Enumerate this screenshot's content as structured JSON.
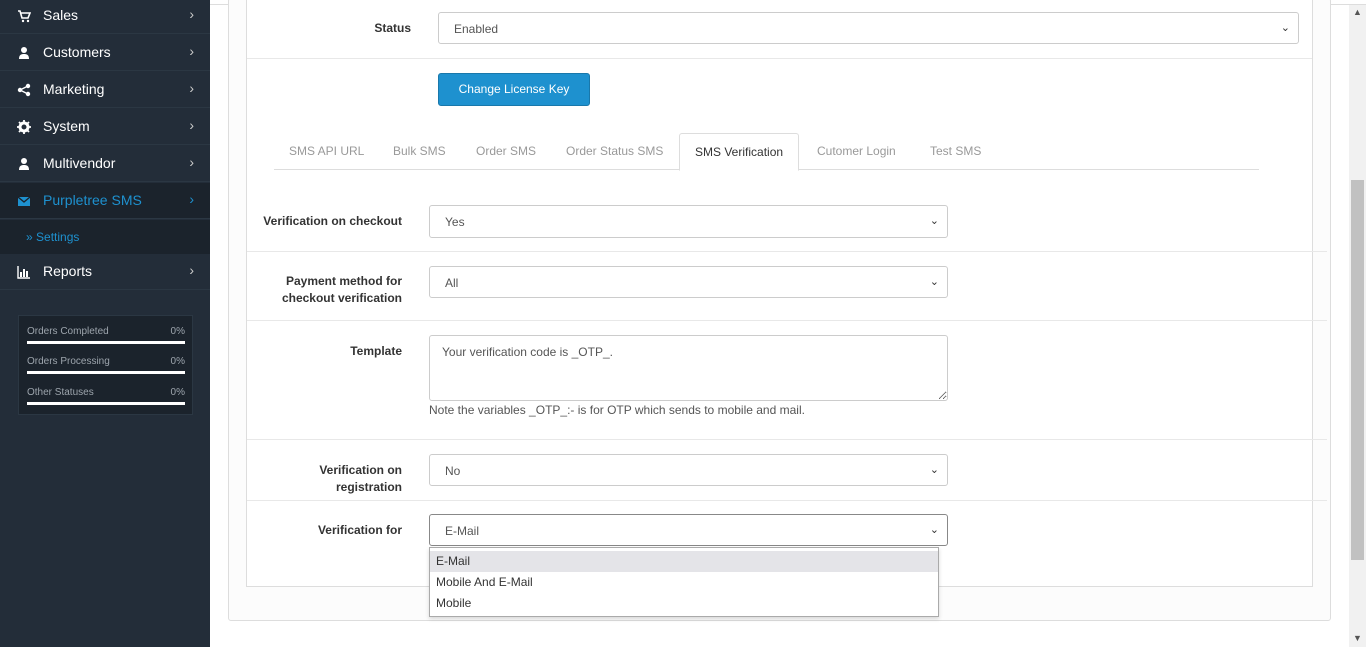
{
  "sidebar": {
    "items": [
      {
        "label": "Sales",
        "icon": "cart-icon"
      },
      {
        "label": "Customers",
        "icon": "user-icon"
      },
      {
        "label": "Marketing",
        "icon": "share-icon"
      },
      {
        "label": "System",
        "icon": "gear-icon"
      },
      {
        "label": "Multivendor",
        "icon": "user-icon"
      },
      {
        "label": "Purpletree SMS",
        "icon": "envelope-icon"
      },
      {
        "label": "Reports",
        "icon": "bar-chart-icon"
      }
    ],
    "sub_item": "Settings",
    "stats": [
      {
        "name": "Orders Completed",
        "pct": "0%"
      },
      {
        "name": "Orders Processing",
        "pct": "0%"
      },
      {
        "name": "Other Statuses",
        "pct": "0%"
      }
    ],
    "accent_color": "#1e91cf"
  },
  "form": {
    "status_label": "Status",
    "status_value": "Enabled",
    "change_license_button": "Change License Key",
    "tabs": [
      "SMS API URL",
      "Bulk SMS",
      "Order SMS",
      "Order Status SMS",
      "SMS Verification",
      "Cutomer Login",
      "Test SMS"
    ],
    "active_tab": "SMS Verification",
    "checkout_label": "Verification on checkout",
    "checkout_value": "Yes",
    "payment_label_line1": "Payment method for",
    "payment_label_line2": "checkout verification",
    "payment_value": "All",
    "template_label": "Template",
    "template_value": "Your verification code is _OTP_.",
    "template_help": "Note the variables _OTP_:- is for OTP which sends to mobile and mail.",
    "registration_label": "Verification on registration",
    "registration_value": "No",
    "verification_for_label": "Verification for",
    "verification_for_value": "E-Mail",
    "verification_for_options": [
      "E-Mail",
      "Mobile And E-Mail",
      "Mobile"
    ]
  }
}
